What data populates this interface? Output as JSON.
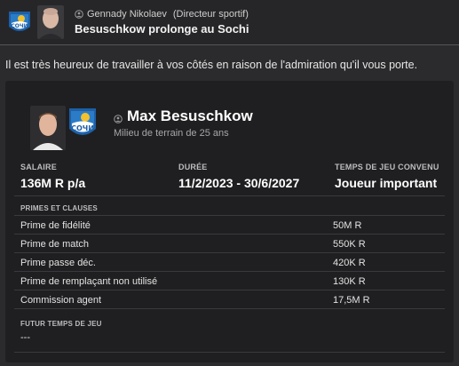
{
  "header": {
    "sender_name": "Gennady Nikolaev",
    "sender_role": "(Directeur sportif)",
    "title": "Besuschkow prolonge au Sochi"
  },
  "message": "Il est très heureux de travailler à vos côtés en raison de l'admiration qu'il vous porte.",
  "player": {
    "name": "Max Besuschkow",
    "description": "Milieu de terrain de 25 ans"
  },
  "contract": {
    "salary_label": "SALAIRE",
    "salary_value": "136M R p/a",
    "duration_label": "DURÉE",
    "duration_value": "11/2/2023 - 30/6/2027",
    "playtime_label": "TEMPS DE JEU CONVENU",
    "playtime_value": "Joueur important"
  },
  "bonuses": {
    "heading": "PRIMES ET CLAUSES",
    "items": [
      {
        "label": "Prime de fidélité",
        "value": "50M R"
      },
      {
        "label": "Prime de match",
        "value": "550K R"
      },
      {
        "label": "Prime passe déc.",
        "value": "420K R"
      },
      {
        "label": "Prime de remplaçant non utilisé",
        "value": "130K R"
      },
      {
        "label": "Commission agent",
        "value": "17,5M R"
      }
    ]
  },
  "future": {
    "heading": "FUTUR TEMPS DE JEU",
    "value": "---"
  },
  "colors": {
    "background": "#2b2b2d",
    "card": "#1f1f21",
    "club_blue": "#2a7cc7",
    "club_yellow": "#f2c230"
  },
  "icons": {
    "person": "person-icon",
    "club": "sochi-club-logo"
  }
}
